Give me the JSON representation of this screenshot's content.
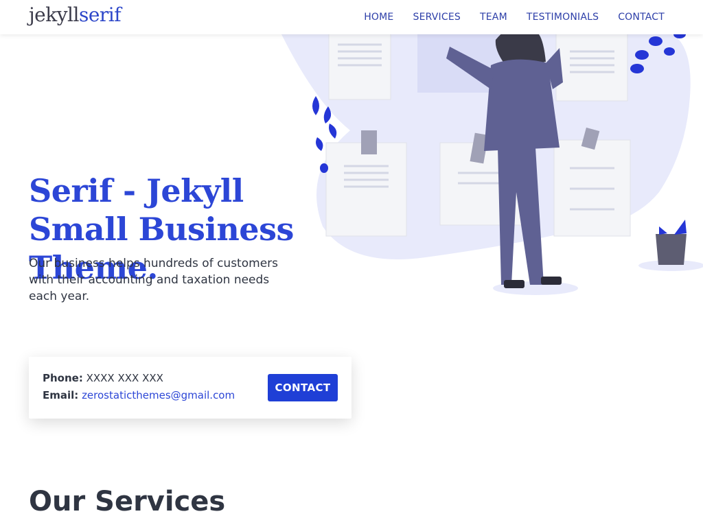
{
  "header": {
    "logo_part1": "jekyll",
    "logo_part2": "serif",
    "nav": [
      "HOME",
      "SERVICES",
      "TEAM",
      "TESTIMONIALS",
      "CONTACT"
    ]
  },
  "hero": {
    "title": "Serif - Jekyll Small Business Theme.",
    "subtitle": "Our business helps hundreds of customers with their accounting and taxation needs each year."
  },
  "contact": {
    "phone_label": "Phone:",
    "phone_value": "XXXX XXX XXX",
    "email_label": "Email:",
    "email_value": "zerostaticthemes@gmail.com",
    "button_label": "CONTACT"
  },
  "services": {
    "title": "Our Services"
  },
  "colors": {
    "accent": "#2c46d6",
    "button": "#1f3fd6",
    "illustration_bg": "#e8eafb",
    "person": "#5f6193"
  }
}
